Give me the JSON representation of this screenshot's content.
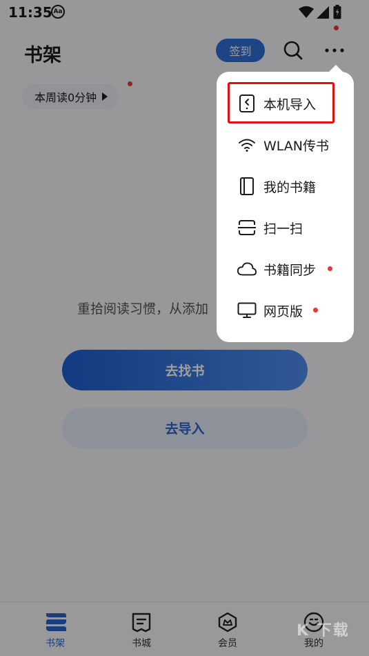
{
  "status_bar": {
    "time": "11:35",
    "font_badge": "Aa"
  },
  "header": {
    "title": "书架",
    "signin_label": "签到"
  },
  "reading": {
    "label": "本周读0分钟"
  },
  "empty_state": {
    "hint": "重拾阅读习惯，从添加",
    "find_label": "去找书",
    "import_label": "去导入"
  },
  "menu": {
    "items": [
      {
        "label": "本机导入",
        "icon": "phone-import-icon",
        "highlighted": true
      },
      {
        "label": "WLAN传书",
        "icon": "wifi-icon"
      },
      {
        "label": "我的书籍",
        "icon": "book-icon"
      },
      {
        "label": "扫一扫",
        "icon": "scan-icon"
      },
      {
        "label": "书籍同步",
        "icon": "cloud-icon",
        "badge": true
      },
      {
        "label": "网页版",
        "icon": "monitor-icon",
        "badge": true
      }
    ]
  },
  "bottom_nav": {
    "items": [
      {
        "label": "书架",
        "icon": "bookshelf-icon",
        "active": true
      },
      {
        "label": "书城",
        "icon": "bookstore-icon"
      },
      {
        "label": "会员",
        "icon": "vip-icon"
      },
      {
        "label": "我的",
        "icon": "profile-icon"
      }
    ]
  },
  "watermark": "K 下载",
  "colors": {
    "accent": "#2f6fd6",
    "badge": "#e53935",
    "highlight": "#e01010"
  }
}
